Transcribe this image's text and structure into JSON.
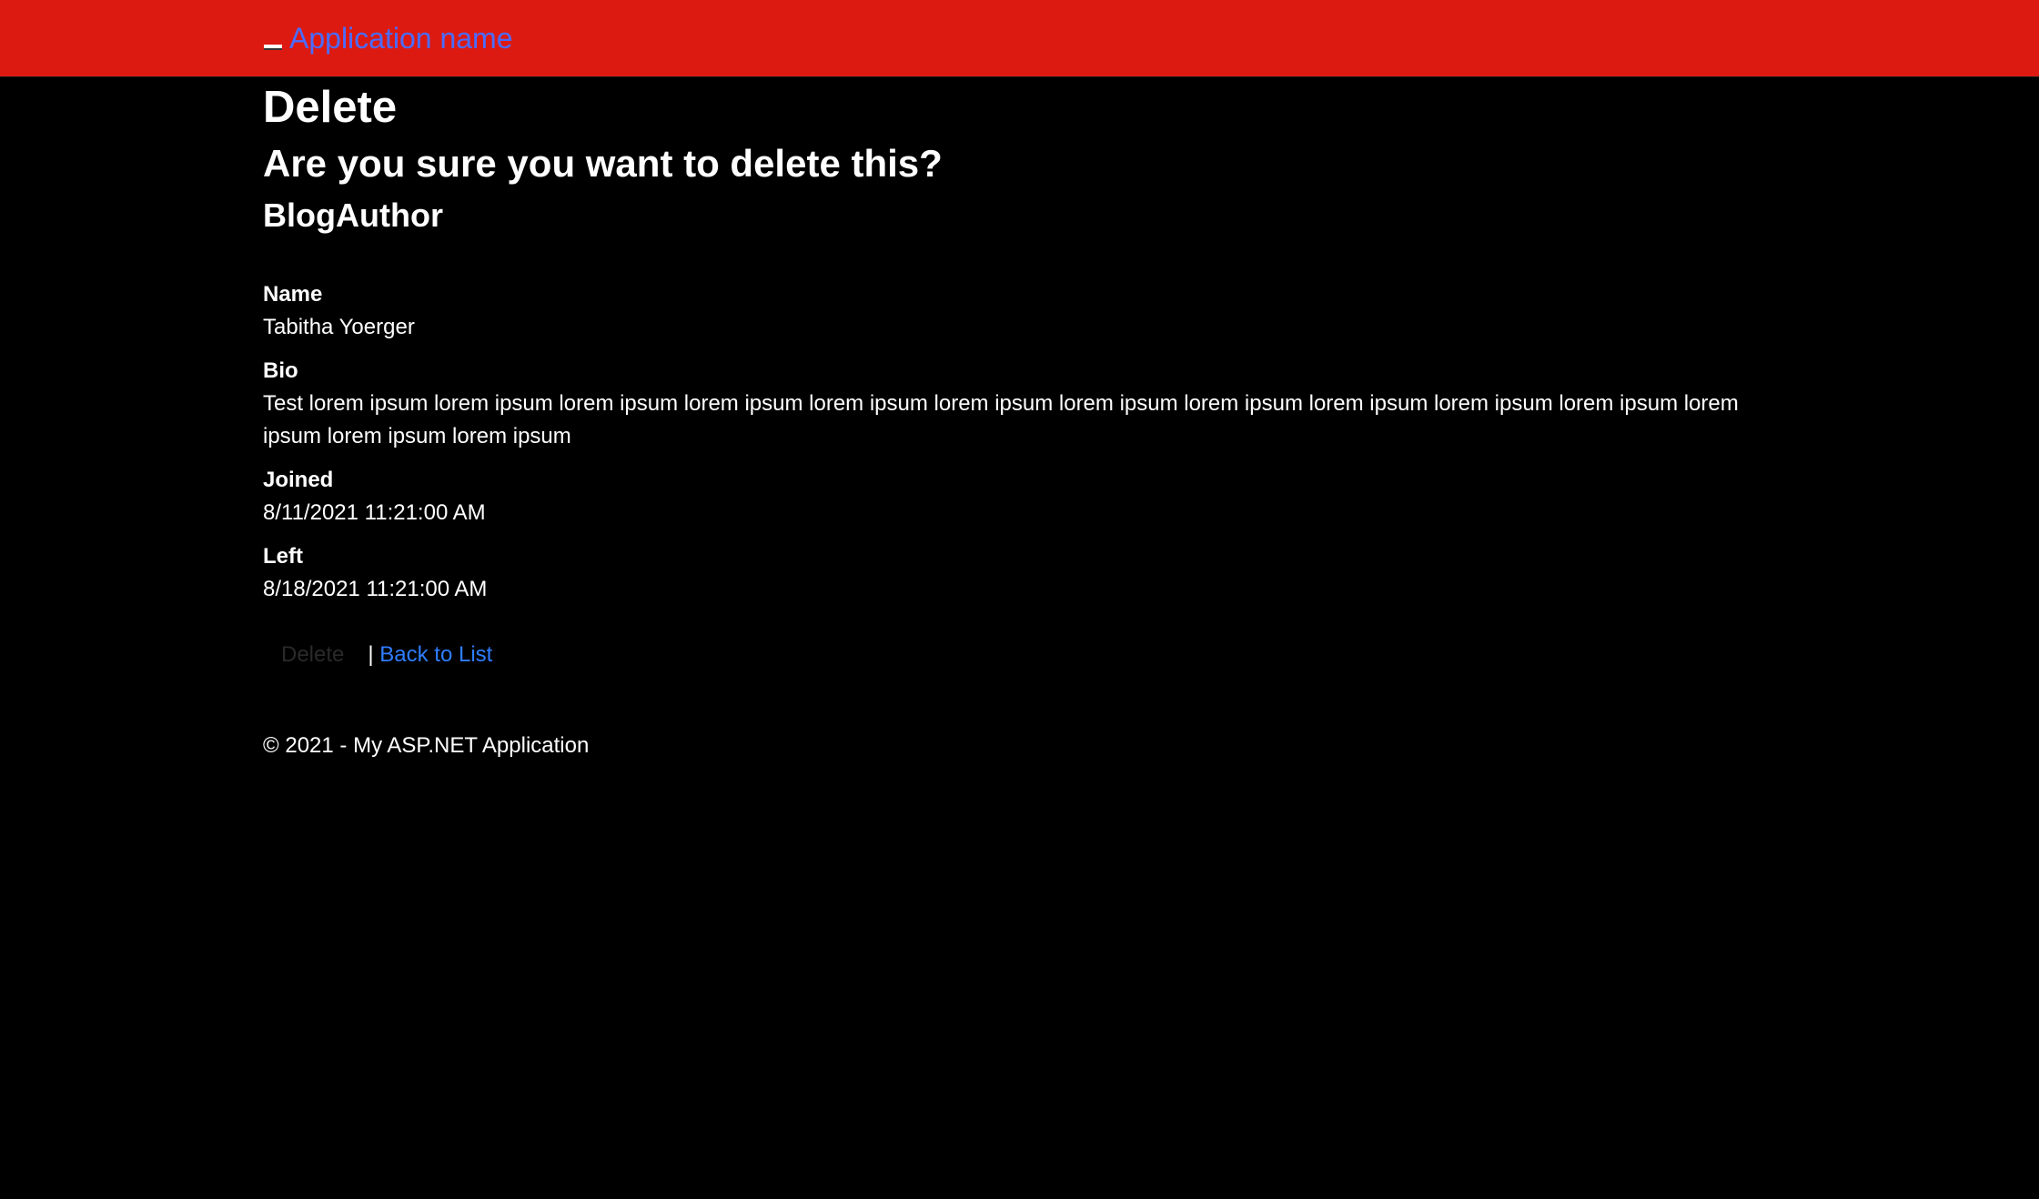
{
  "navbar": {
    "brand": "Application name",
    "background_color": "#dc1a12",
    "brand_color": "#4a6cff",
    "toggle_icon": "menu-icon"
  },
  "page": {
    "title": "Delete",
    "question": "Are you sure you want to delete this?",
    "entity": "BlogAuthor"
  },
  "details": [
    {
      "label": "Name",
      "value": "Tabitha Yoerger"
    },
    {
      "label": "Bio",
      "value": "Test lorem ipsum lorem ipsum lorem ipsum lorem ipsum lorem ipsum lorem ipsum lorem ipsum lorem ipsum lorem ipsum lorem ipsum lorem ipsum lorem ipsum lorem ipsum lorem ipsum"
    },
    {
      "label": "Joined",
      "value": "8/11/2021 11:21:00 AM"
    },
    {
      "label": "Left",
      "value": "8/18/2021 11:21:00 AM"
    }
  ],
  "actions": {
    "delete_label": "Delete",
    "separator": "|",
    "back_label": "Back to List",
    "link_color": "#2f7dff"
  },
  "footer": {
    "text": "© 2021 - My ASP.NET Application"
  }
}
